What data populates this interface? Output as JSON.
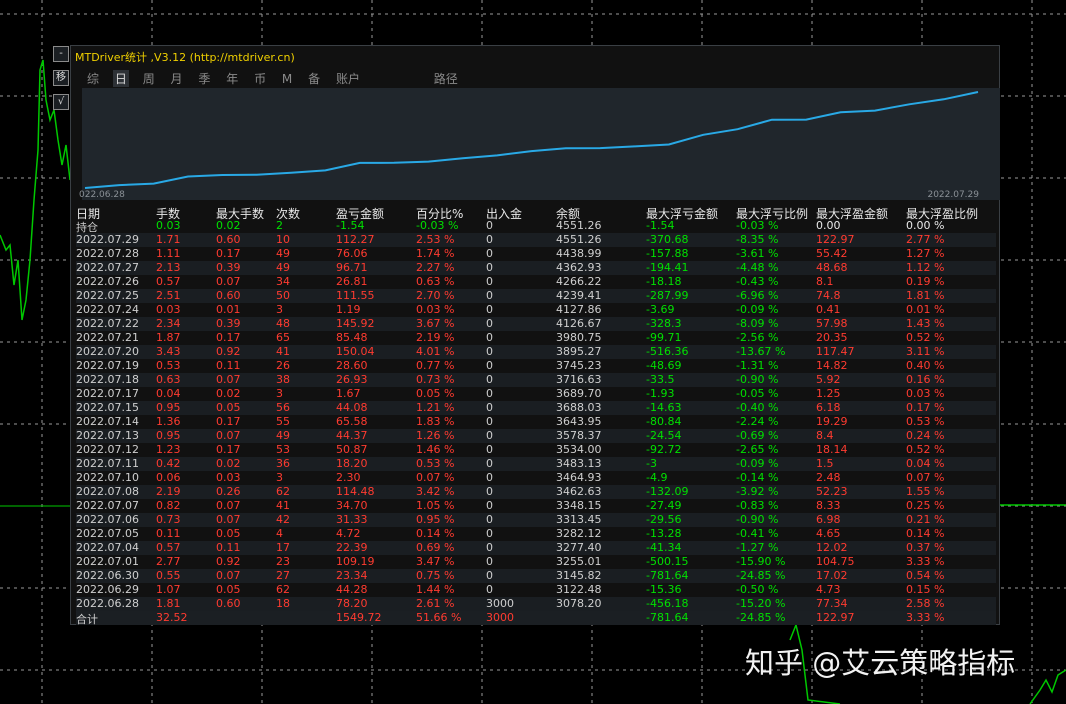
{
  "window": {
    "title": "MTDriver统计 ,V3.12 (http://mtdriver.cn)",
    "side_buttons": [
      "-",
      "移",
      "√"
    ]
  },
  "tabs": {
    "items": [
      "综",
      "日",
      "周",
      "月",
      "季",
      "年",
      "币",
      "M",
      "备",
      "账户"
    ],
    "active": "日",
    "path": "路径"
  },
  "equity_curve": {
    "start_label": "022.06.28",
    "end_label": "2022.07.29",
    "series_color": "#29a9e6",
    "x": [
      "2022.06.28",
      "2022.06.29",
      "2022.06.30",
      "2022.07.01",
      "2022.07.04",
      "2022.07.05",
      "2022.07.06",
      "2022.07.07",
      "2022.07.08",
      "2022.07.10",
      "2022.07.11",
      "2022.07.12",
      "2022.07.13",
      "2022.07.14",
      "2022.07.15",
      "2022.07.17",
      "2022.07.18",
      "2022.07.19",
      "2022.07.20",
      "2022.07.21",
      "2022.07.22",
      "2022.07.24",
      "2022.07.25",
      "2022.07.26",
      "2022.07.27",
      "2022.07.28",
      "2022.07.29"
    ],
    "values": [
      3078.2,
      3122.48,
      3145.82,
      3255.01,
      3277.4,
      3282.12,
      3313.45,
      3348.15,
      3462.63,
      3464.93,
      3483.13,
      3534.0,
      3578.37,
      3643.95,
      3688.03,
      3689.7,
      3716.63,
      3745.23,
      3895.27,
      3980.75,
      4126.67,
      4127.86,
      4239.41,
      4266.22,
      4362.93,
      4438.99,
      4551.26
    ]
  },
  "table": {
    "columns": [
      "日期",
      "手数",
      "最大手数",
      "次数",
      "盈亏金额",
      "百分比%",
      "出入金",
      "余额",
      "最大浮亏金额",
      "最大浮亏比例",
      "最大浮盈金额",
      "最大浮盈比例"
    ],
    "holding": [
      "持仓",
      "0.03",
      "0.02",
      "2",
      "-1.54",
      "-0.03 %",
      "0",
      "4551.26",
      "-1.54",
      "-0.03 %",
      "0.00",
      "0.00 %"
    ],
    "rows": [
      [
        "2022.07.29",
        "1.71",
        "0.60",
        "10",
        "112.27",
        "2.53 %",
        "0",
        "4551.26",
        "-370.68",
        "-8.35 %",
        "122.97",
        "2.77 %"
      ],
      [
        "2022.07.28",
        "1.11",
        "0.17",
        "49",
        "76.06",
        "1.74 %",
        "0",
        "4438.99",
        "-157.88",
        "-3.61 %",
        "55.42",
        "1.27 %"
      ],
      [
        "2022.07.27",
        "2.13",
        "0.39",
        "49",
        "96.71",
        "2.27 %",
        "0",
        "4362.93",
        "-194.41",
        "-4.48 %",
        "48.68",
        "1.12 %"
      ],
      [
        "2022.07.26",
        "0.57",
        "0.07",
        "34",
        "26.81",
        "0.63 %",
        "0",
        "4266.22",
        "-18.18",
        "-0.43 %",
        "8.1",
        "0.19 %"
      ],
      [
        "2022.07.25",
        "2.51",
        "0.60",
        "50",
        "111.55",
        "2.70 %",
        "0",
        "4239.41",
        "-287.99",
        "-6.96 %",
        "74.8",
        "1.81 %"
      ],
      [
        "2022.07.24",
        "0.03",
        "0.01",
        "3",
        "1.19",
        "0.03 %",
        "0",
        "4127.86",
        "-3.69",
        "-0.09 %",
        "0.41",
        "0.01 %"
      ],
      [
        "2022.07.22",
        "2.34",
        "0.39",
        "48",
        "145.92",
        "3.67 %",
        "0",
        "4126.67",
        "-328.3",
        "-8.09 %",
        "57.98",
        "1.43 %"
      ],
      [
        "2022.07.21",
        "1.87",
        "0.17",
        "65",
        "85.48",
        "2.19 %",
        "0",
        "3980.75",
        "-99.71",
        "-2.56 %",
        "20.35",
        "0.52 %"
      ],
      [
        "2022.07.20",
        "3.43",
        "0.92",
        "41",
        "150.04",
        "4.01 %",
        "0",
        "3895.27",
        "-516.36",
        "-13.67 %",
        "117.47",
        "3.11 %"
      ],
      [
        "2022.07.19",
        "0.53",
        "0.11",
        "26",
        "28.60",
        "0.77 %",
        "0",
        "3745.23",
        "-48.69",
        "-1.31 %",
        "14.82",
        "0.40 %"
      ],
      [
        "2022.07.18",
        "0.63",
        "0.07",
        "38",
        "26.93",
        "0.73 %",
        "0",
        "3716.63",
        "-33.5",
        "-0.90 %",
        "5.92",
        "0.16 %"
      ],
      [
        "2022.07.17",
        "0.04",
        "0.02",
        "3",
        "1.67",
        "0.05 %",
        "0",
        "3689.70",
        "-1.93",
        "-0.05 %",
        "1.25",
        "0.03 %"
      ],
      [
        "2022.07.15",
        "0.95",
        "0.05",
        "56",
        "44.08",
        "1.21 %",
        "0",
        "3688.03",
        "-14.63",
        "-0.40 %",
        "6.18",
        "0.17 %"
      ],
      [
        "2022.07.14",
        "1.36",
        "0.17",
        "55",
        "65.58",
        "1.83 %",
        "0",
        "3643.95",
        "-80.84",
        "-2.24 %",
        "19.29",
        "0.53 %"
      ],
      [
        "2022.07.13",
        "0.95",
        "0.07",
        "49",
        "44.37",
        "1.26 %",
        "0",
        "3578.37",
        "-24.54",
        "-0.69 %",
        "8.4",
        "0.24 %"
      ],
      [
        "2022.07.12",
        "1.23",
        "0.17",
        "53",
        "50.87",
        "1.46 %",
        "0",
        "3534.00",
        "-92.72",
        "-2.65 %",
        "18.14",
        "0.52 %"
      ],
      [
        "2022.07.11",
        "0.42",
        "0.02",
        "36",
        "18.20",
        "0.53 %",
        "0",
        "3483.13",
        "-3",
        "-0.09 %",
        "1.5",
        "0.04 %"
      ],
      [
        "2022.07.10",
        "0.06",
        "0.03",
        "3",
        "2.30",
        "0.07 %",
        "0",
        "3464.93",
        "-4.9",
        "-0.14 %",
        "2.48",
        "0.07 %"
      ],
      [
        "2022.07.08",
        "2.19",
        "0.26",
        "62",
        "114.48",
        "3.42 %",
        "0",
        "3462.63",
        "-132.09",
        "-3.92 %",
        "52.23",
        "1.55 %"
      ],
      [
        "2022.07.07",
        "0.82",
        "0.07",
        "41",
        "34.70",
        "1.05 %",
        "0",
        "3348.15",
        "-27.49",
        "-0.83 %",
        "8.33",
        "0.25 %"
      ],
      [
        "2022.07.06",
        "0.73",
        "0.07",
        "42",
        "31.33",
        "0.95 %",
        "0",
        "3313.45",
        "-29.56",
        "-0.90 %",
        "6.98",
        "0.21 %"
      ],
      [
        "2022.07.05",
        "0.11",
        "0.05",
        "4",
        "4.72",
        "0.14 %",
        "0",
        "3282.12",
        "-13.28",
        "-0.41 %",
        "4.65",
        "0.14 %"
      ],
      [
        "2022.07.04",
        "0.57",
        "0.11",
        "17",
        "22.39",
        "0.69 %",
        "0",
        "3277.40",
        "-41.34",
        "-1.27 %",
        "12.02",
        "0.37 %"
      ],
      [
        "2022.07.01",
        "2.77",
        "0.92",
        "23",
        "109.19",
        "3.47 %",
        "0",
        "3255.01",
        "-500.15",
        "-15.90 %",
        "104.75",
        "3.33 %"
      ],
      [
        "2022.06.30",
        "0.55",
        "0.07",
        "27",
        "23.34",
        "0.75 %",
        "0",
        "3145.82",
        "-781.64",
        "-24.85 %",
        "17.02",
        "0.54 %"
      ],
      [
        "2022.06.29",
        "1.07",
        "0.05",
        "62",
        "44.28",
        "1.44 %",
        "0",
        "3122.48",
        "-15.36",
        "-0.50 %",
        "4.73",
        "0.15 %"
      ],
      [
        "2022.06.28",
        "1.81",
        "0.60",
        "18",
        "78.20",
        "2.61 %",
        "3000",
        "3078.20",
        "-456.18",
        "-15.20 %",
        "77.34",
        "2.58 %"
      ]
    ],
    "footer": [
      "合计",
      "32.52",
      "",
      "",
      "1549.72",
      "51.66 %",
      "3000",
      "",
      "-781.64",
      "-24.85 %",
      "122.97",
      "3.33 %"
    ]
  },
  "watermark": "知乎 @艾云策略指标",
  "colors": {
    "positive": "#ff3b30",
    "negative": "#00e000",
    "title": "#f0d000",
    "chart_bg": "#20262c"
  }
}
